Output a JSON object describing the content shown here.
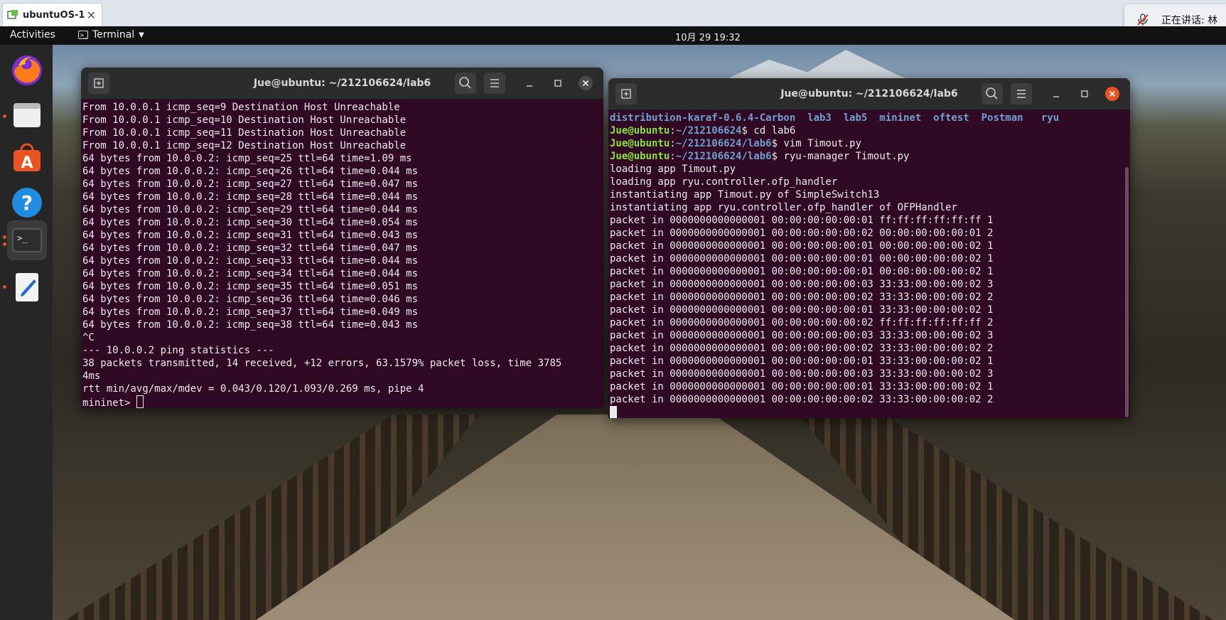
{
  "host": {
    "tab_title": "ubuntuOS-1",
    "tab_close": "✕",
    "meeting_text": "正在讲话: 林"
  },
  "panel": {
    "activities": "Activities",
    "app_name": "Terminal",
    "clock": "10月 29  19:32"
  },
  "dock": {
    "items": [
      "firefox",
      "files",
      "software",
      "help",
      "terminal",
      "text-editor"
    ]
  },
  "left_terminal": {
    "title": "Jue@ubuntu: ~/212106624/lab6",
    "lines": [
      "From 10.0.0.1 icmp_seq=9 Destination Host Unreachable",
      "From 10.0.0.1 icmp_seq=10 Destination Host Unreachable",
      "From 10.0.0.1 icmp_seq=11 Destination Host Unreachable",
      "From 10.0.0.1 icmp_seq=12 Destination Host Unreachable",
      "64 bytes from 10.0.0.2: icmp_seq=25 ttl=64 time=1.09 ms",
      "64 bytes from 10.0.0.2: icmp_seq=26 ttl=64 time=0.044 ms",
      "64 bytes from 10.0.0.2: icmp_seq=27 ttl=64 time=0.047 ms",
      "64 bytes from 10.0.0.2: icmp_seq=28 ttl=64 time=0.044 ms",
      "64 bytes from 10.0.0.2: icmp_seq=29 ttl=64 time=0.044 ms",
      "64 bytes from 10.0.0.2: icmp_seq=30 ttl=64 time=0.054 ms",
      "64 bytes from 10.0.0.2: icmp_seq=31 ttl=64 time=0.043 ms",
      "64 bytes from 10.0.0.2: icmp_seq=32 ttl=64 time=0.047 ms",
      "64 bytes from 10.0.0.2: icmp_seq=33 ttl=64 time=0.044 ms",
      "64 bytes from 10.0.0.2: icmp_seq=34 ttl=64 time=0.044 ms",
      "64 bytes from 10.0.0.2: icmp_seq=35 ttl=64 time=0.051 ms",
      "64 bytes from 10.0.0.2: icmp_seq=36 ttl=64 time=0.046 ms",
      "64 bytes from 10.0.0.2: icmp_seq=37 ttl=64 time=0.049 ms",
      "64 bytes from 10.0.0.2: icmp_seq=38 ttl=64 time=0.043 ms",
      "^C",
      "--- 10.0.0.2 ping statistics ---",
      "38 packets transmitted, 14 received, +12 errors, 63.1579% packet loss, time 3785",
      "4ms",
      "rtt min/avg/max/mdev = 0.043/0.120/1.093/0.269 ms, pipe 4"
    ],
    "prompt": "mininet> "
  },
  "right_terminal": {
    "title": "Jue@ubuntu: ~/212106624/lab6",
    "ls_line": "distribution-karaf-0.6.4-Carbon  lab3  lab5  mininet  oftest  Postman   ryu",
    "commands": [
      {
        "user": "Jue@ubuntu",
        "path": "~/212106624",
        "cmd": "cd lab6"
      },
      {
        "user": "Jue@ubuntu",
        "path": "~/212106624/lab6",
        "cmd": "vim Timout.py"
      },
      {
        "user": "Jue@ubuntu",
        "path": "~/212106624/lab6",
        "cmd": "ryu-manager Timout.py"
      }
    ],
    "lines": [
      "loading app Timout.py",
      "loading app ryu.controller.ofp_handler",
      "instantiating app Timout.py of SimpleSwitch13",
      "instantiating app ryu.controller.ofp_handler of OFPHandler",
      "packet in 0000000000000001 00:00:00:00:00:01 ff:ff:ff:ff:ff:ff 1",
      "packet in 0000000000000001 00:00:00:00:00:02 00:00:00:00:00:01 2",
      "packet in 0000000000000001 00:00:00:00:00:01 00:00:00:00:00:02 1",
      "packet in 0000000000000001 00:00:00:00:00:01 00:00:00:00:00:02 1",
      "packet in 0000000000000001 00:00:00:00:00:01 00:00:00:00:00:02 1",
      "packet in 0000000000000001 00:00:00:00:00:03 33:33:00:00:00:02 3",
      "packet in 0000000000000001 00:00:00:00:00:02 33:33:00:00:00:02 2",
      "packet in 0000000000000001 00:00:00:00:00:01 33:33:00:00:00:02 1",
      "packet in 0000000000000001 00:00:00:00:00:02 ff:ff:ff:ff:ff:ff 2",
      "packet in 0000000000000001 00:00:00:00:00:03 33:33:00:00:00:02 3",
      "packet in 0000000000000001 00:00:00:00:00:02 33:33:00:00:00:02 2",
      "packet in 0000000000000001 00:00:00:00:00:01 33:33:00:00:00:02 1",
      "packet in 0000000000000001 00:00:00:00:00:03 33:33:00:00:00:02 3",
      "packet in 0000000000000001 00:00:00:00:00:01 33:33:00:00:00:02 1",
      "packet in 0000000000000001 00:00:00:00:00:02 33:33:00:00:00:02 2"
    ]
  },
  "colors": {
    "terminal_bg": "#300a24",
    "user_green": "#8ae234",
    "path_blue": "#729fcf",
    "accent_orange": "#e95420"
  }
}
